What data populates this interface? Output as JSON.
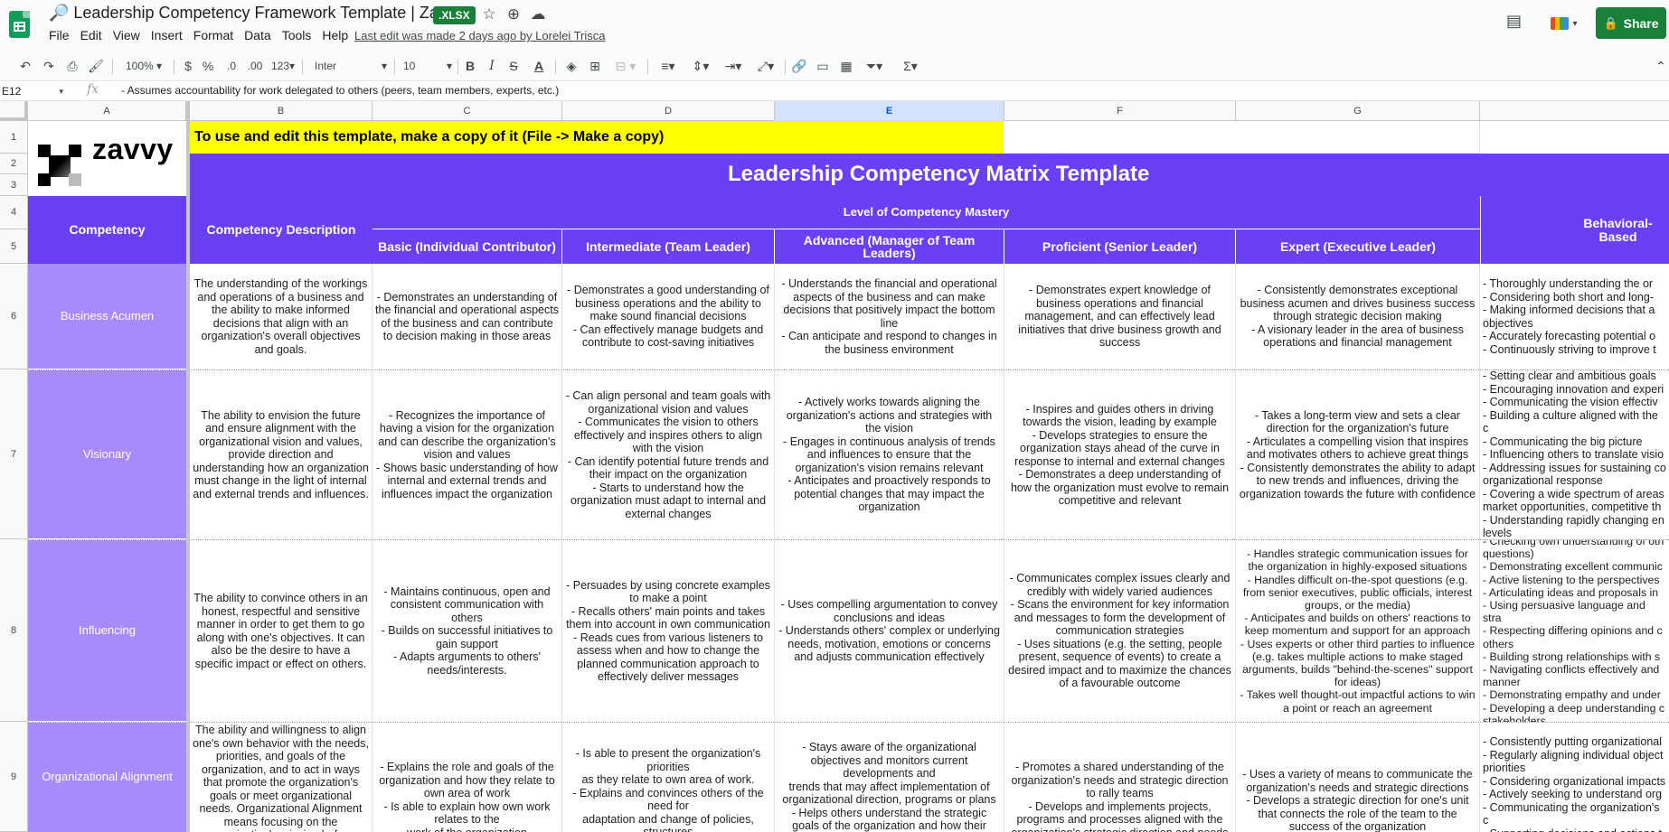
{
  "app": {
    "doc_title": "🔎 Leadership Competency Framework Template | Zavvy",
    "badge": ".XLSX",
    "last_edit": "Last edit was made 2 days ago by Lorelei Trisca",
    "share_label": "Share",
    "menu": [
      "File",
      "Edit",
      "View",
      "Insert",
      "Format",
      "Data",
      "Tools",
      "Help"
    ]
  },
  "toolbar": {
    "zoom": "100%",
    "currency": "$",
    "percent": "%",
    "dec_decrease": ".0",
    "dec_increase": ".00",
    "more_formats": "123",
    "font": "Inter",
    "font_size": "10"
  },
  "formula_bar": {
    "cell_ref": "E12",
    "fx": "fx",
    "content": "- Assumes accountability for work delegated to others (peers, team members, experts, etc.)"
  },
  "columns": [
    "A",
    "B",
    "C",
    "D",
    "E",
    "F",
    "G"
  ],
  "rows": [
    "1",
    "2",
    "3",
    "4",
    "5",
    "6",
    "7",
    "8",
    "9"
  ],
  "sheet": {
    "logo_text": "zavvy",
    "banner": "To use and edit this template, make a copy of it (File -> Make a copy)",
    "title": "Leadership Competency Matrix Template",
    "competency_header": "Competency",
    "description_header": "Competency Description",
    "mastery_header": "Level of Competency Mastery",
    "behavioral_header": "Behavioral-Based",
    "levels": [
      "Basic (Individual Contributor)",
      "Intermediate (Team Leader)",
      "Advanced (Manager of Team Leaders)",
      "Proficient (Senior Leader)",
      "Expert (Executive Leader)"
    ],
    "competencies": [
      {
        "name": "Business Acumen",
        "description": "The understanding of the workings and operations of a business and the ability to make informed decisions that align with an organization's overall objectives and goals.",
        "basic": "- Demonstrates an understanding of the financial and operational aspects of the business and can contribute to decision making in those areas",
        "intermediate": "- Demonstrates a good understanding of business operations and the ability to make sound financial decisions\n- Can effectively manage budgets and contribute to cost-saving initiatives",
        "advanced": "- Understands the financial and operational aspects of the business and can make decisions that positively impact the bottom line\n- Can anticipate and respond to changes in the business environment",
        "proficient": "- Demonstrates expert knowledge of business operations and financial management, and can effectively lead initiatives that drive business growth and success",
        "expert": "- Consistently demonstrates exceptional business acumen and drives business success through strategic decision making\n- A visionary leader in the area of business operations and financial management",
        "behavioral": "- Thoroughly understanding the or\n- Considering both short and long-\n- Making informed decisions that a\nobjectives\n- Accurately forecasting potential o\n- Continuously striving to improve t"
      },
      {
        "name": "Visionary",
        "description": "The ability to envision the future and ensure alignment with the organizational vision and values, provide direction and understanding how an organization must change in the light of internal and external trends and influences.",
        "basic": "- Recognizes the importance of having a vision for the organization and can describe the organization's vision and values\n- Shows basic understanding of how internal and external trends and influences impact the organization",
        "intermediate": "- Can align personal and team goals with organizational vision and values\n- Communicates the vision to others effectively and inspires others to align with the vision\n- Can identify potential future trends and their impact on the organization\n- Starts to understand how the organization must adapt to internal and external changes",
        "advanced": "- Actively works towards aligning the organization's actions and strategies with the vision\n- Engages in continuous analysis of trends and influences to ensure that the organization's vision remains relevant\n- Anticipates and proactively responds to potential changes that may impact the organization",
        "proficient": "- Inspires and guides others in driving towards the vision, leading by example\n- Develops strategies to ensure the organization stays ahead of the curve in response to internal and external changes\n- Demonstrates a deep understanding of how the organization must evolve to remain competitive and relevant",
        "expert": "- Takes a long-term view and sets a clear direction for the organization's future\n- Articulates a compelling vision that inspires and motivates others to achieve great things\n- Consistently demonstrates the ability to adapt to new trends and influences, driving the organization towards the future with confidence",
        "behavioral": "- Setting clear and ambitious goals\n- Encouraging innovation and experi\n- Communicating the vision effectiv\n- Building a culture aligned with the c\n- Communicating the big picture\n- Influencing others to translate visio\n- Addressing issues for sustaining co\norganizational response\n- Covering a wide spectrum of areas\nmarket opportunities, competitive th\n- Understanding rapidly changing en\nlevels"
      },
      {
        "name": "Influencing",
        "description": "The ability to convince others in an honest, respectful and sensitive manner in order to get them to go along with one's objectives. It can also be the desire to have a specific impact or effect on others.",
        "basic": "- Maintains continuous, open and consistent communication with others\n- Builds on successful initiatives to gain support\n- Adapts arguments to others' needs/interests.",
        "intermediate": "- Persuades by using concrete examples to make a point\n- Recalls others' main points and takes them into account in own communication\n- Reads cues from various listeners to assess when and how to change the planned communication approach to effectively deliver messages",
        "advanced": "- Uses compelling argumentation to convey conclusions and ideas\n- Understands others' complex or underlying needs, motivation, emotions or concerns and adjusts communication effectively",
        "proficient": "- Communicates complex issues clearly and credibly with widely varied audiences\n- Scans the environment for key information and messages to form the development of communication strategies\n- Uses situations (e.g. the setting, people present, sequence of events) to create a desired impact and to maximize the chances of a favourable outcome",
        "expert": "- Handles strategic communication issues for the organization in highly-exposed situations\n- Handles difficult on-the-spot questions (e.g. from senior executives, public officials, interest groups, or the media)\n- Anticipates and builds on others' reactions to keep momentum and support for an approach\n- Uses experts or other third parties to influence (e.g. takes multiple actions to make staged arguments, builds \"behind-the-scenes\" support for ideas)\n- Takes well thought-out impactful actions to win a point or reach an agreement",
        "behavioral": "- Checking own understanding of oth\nquestions)\n- Demonstrating excellent communic\n- Active listening to the perspectives\n- Articulating ideas and proposals in\n- Using persuasive language and stra\n- Respecting differing opinions and c\nothers\n- Building strong relationships with s\n- Navigating conflicts effectively and\nmanner\n- Demonstrating empathy and under\n- Developing a deep understanding c\nstakeholders"
      },
      {
        "name": "Organizational Alignment",
        "description": "The ability and willingness to align one's own behavior with the needs, priorities, and goals of the organization, and to act in ways that promote the organization's goals or meet organizational needs. Organizational Alignment means focusing on the organization's mission before",
        "basic": "- Explains the role and goals of the organization and how they relate to own area of work\n- Is able to explain how own work relates to the\nwork of the organization",
        "intermediate": "- Is able to present the organization's priorities\nas they relate to own area of work.\n- Explains and convinces others of the need for\nadaptation and change of policies, structures",
        "advanced": "- Stays aware of the organizational objectives and monitors current developments and\ntrends that may affect implementation of organizational direction, programs or plans\n- Helps others understand the strategic goals of the organization and how their",
        "proficient": "- Promotes a shared understanding of the organization's needs and strategic direction to rally teams\n- Develops and implements projects, programs and processes aligned with the organization's strategic direction and needs",
        "expert": "- Uses a variety of means to communicate the organization's needs and strategic directions\n- Develops a strategic direction for one's unit that connects the role of the team to the success of the organization",
        "behavioral": "- Consistently putting organizational\n- Regularly aligning individual object\npriorities\n- Considering organizational impacts\n- Actively seeking to understand org\n- Communicating the organization's c\n- Supporting decisions and actions t\n- Acting as a role model by demonst"
      }
    ]
  }
}
